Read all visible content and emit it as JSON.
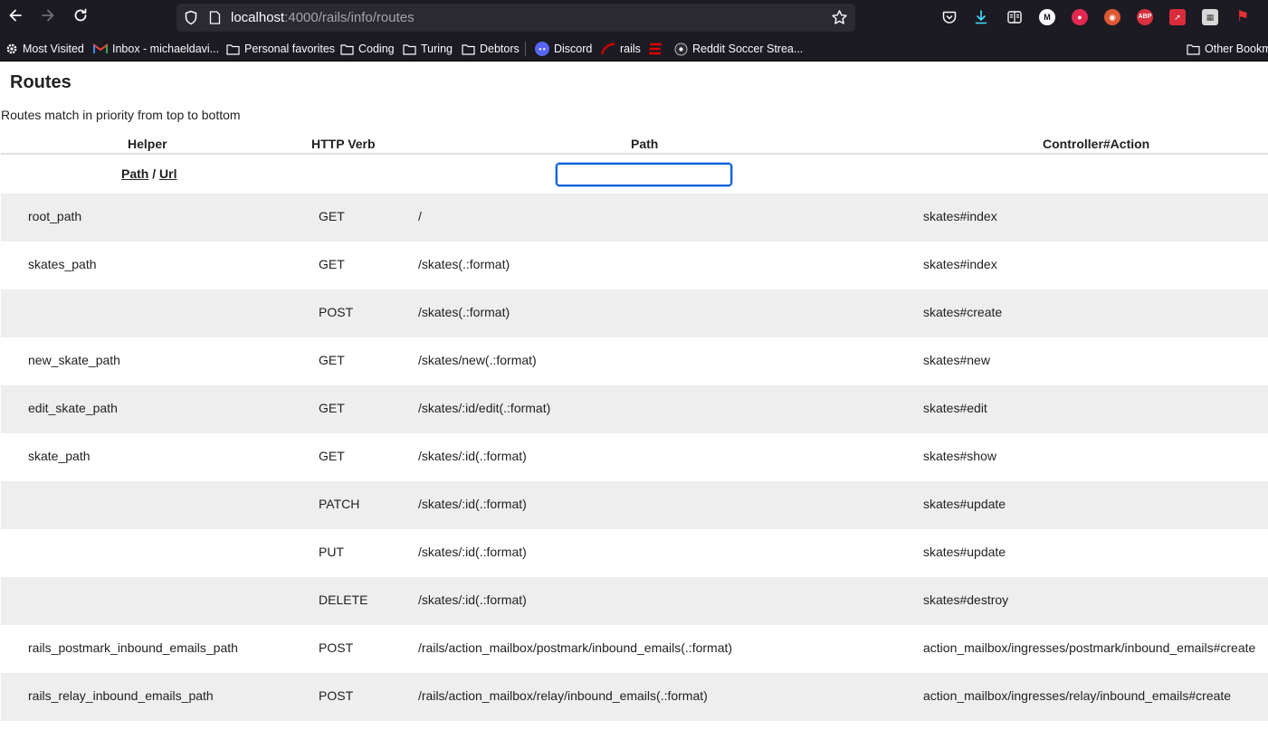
{
  "browser": {
    "url_host": "localhost",
    "url_rest": ":4000/rails/info/routes",
    "bookmarks": [
      {
        "label": "Most Visited",
        "icon": "gear-icon"
      },
      {
        "label": "Inbox - michaeldavi...",
        "icon": "gmail-icon"
      },
      {
        "label": "Personal favorites",
        "icon": "folder-icon"
      },
      {
        "label": "Coding",
        "icon": "folder-icon"
      },
      {
        "label": "Turing",
        "icon": "folder-icon"
      },
      {
        "label": "Debtors",
        "icon": "folder-icon"
      },
      {
        "label": "Discord",
        "icon": "discord-icon"
      },
      {
        "label": "rails",
        "icon": "rails-icon"
      },
      {
        "label": "",
        "icon": "espn-icon"
      },
      {
        "label": "Reddit Soccer Strea...",
        "icon": "soccer-ball-icon"
      },
      {
        "label": "Other Bookmarks",
        "icon": "folder-icon"
      }
    ],
    "extensions": [
      {
        "name": "pocket-icon",
        "text": ""
      },
      {
        "name": "download-icon",
        "text": ""
      },
      {
        "name": "reader-view-icon",
        "text": ""
      },
      {
        "name": "medium-extension-icon",
        "text": "M"
      },
      {
        "name": "lock-extension-icon",
        "text": ""
      },
      {
        "name": "duckduckgo-icon",
        "text": ""
      },
      {
        "name": "adblock-plus-icon",
        "text": "ABP"
      },
      {
        "name": "highlighter-extension-icon",
        "text": ""
      },
      {
        "name": "screenshot-extension-icon",
        "text": ""
      },
      {
        "name": "flag-extension-icon",
        "text": ""
      }
    ]
  },
  "page": {
    "title": "Routes",
    "description": "Routes match in priority from top to bottom"
  },
  "table": {
    "headers": {
      "helper": "Helper",
      "verb": "HTTP Verb",
      "path": "Path",
      "action": "Controller#Action"
    },
    "toggle": {
      "path": "Path",
      "separator": " / ",
      "url": "Url"
    },
    "search": {
      "value": "",
      "placeholder": ""
    },
    "rows": [
      {
        "helper": "root_path",
        "verb": "GET",
        "path": "/",
        "action": "skates#index"
      },
      {
        "helper": "skates_path",
        "verb": "GET",
        "path": "/skates(.:format)",
        "action": "skates#index"
      },
      {
        "helper": "",
        "verb": "POST",
        "path": "/skates(.:format)",
        "action": "skates#create"
      },
      {
        "helper": "new_skate_path",
        "verb": "GET",
        "path": "/skates/new(.:format)",
        "action": "skates#new"
      },
      {
        "helper": "edit_skate_path",
        "verb": "GET",
        "path": "/skates/:id/edit(.:format)",
        "action": "skates#edit"
      },
      {
        "helper": "skate_path",
        "verb": "GET",
        "path": "/skates/:id(.:format)",
        "action": "skates#show"
      },
      {
        "helper": "",
        "verb": "PATCH",
        "path": "/skates/:id(.:format)",
        "action": "skates#update"
      },
      {
        "helper": "",
        "verb": "PUT",
        "path": "/skates/:id(.:format)",
        "action": "skates#update"
      },
      {
        "helper": "",
        "verb": "DELETE",
        "path": "/skates/:id(.:format)",
        "action": "skates#destroy"
      },
      {
        "helper": "rails_postmark_inbound_emails_path",
        "verb": "POST",
        "path": "/rails/action_mailbox/postmark/inbound_emails(.:format)",
        "action": "action_mailbox/ingresses/postmark/inbound_emails#create"
      },
      {
        "helper": "rails_relay_inbound_emails_path",
        "verb": "POST",
        "path": "/rails/action_mailbox/relay/inbound_emails(.:format)",
        "action": "action_mailbox/ingresses/relay/inbound_emails#create"
      }
    ]
  }
}
